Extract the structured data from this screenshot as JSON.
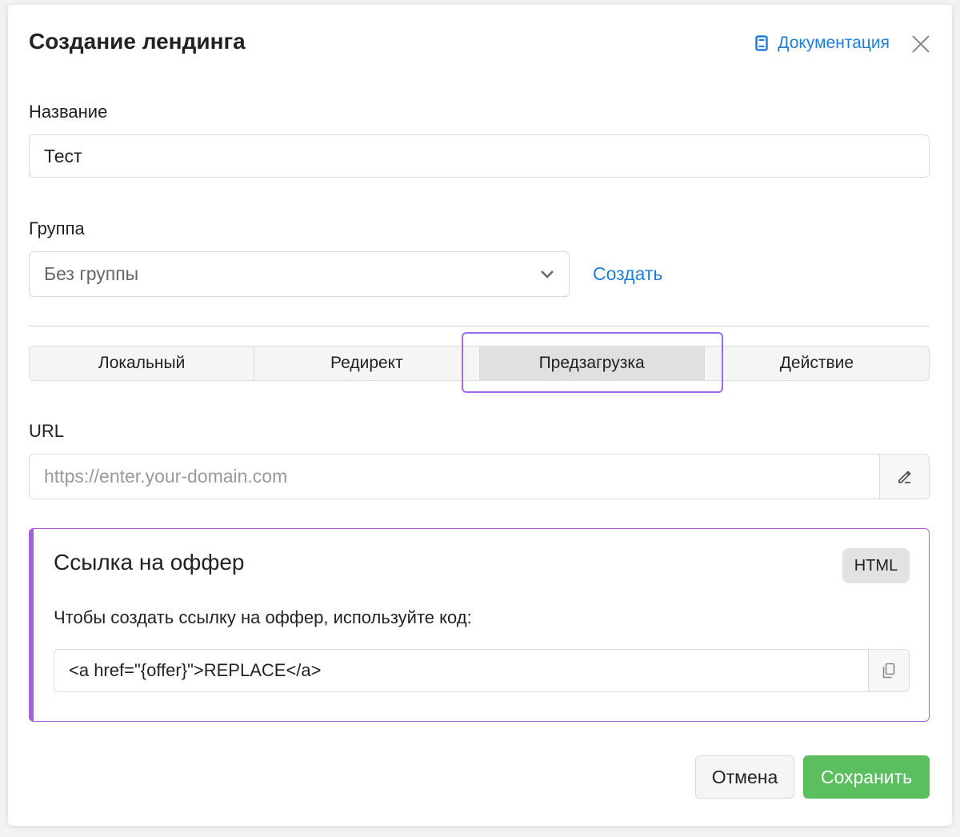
{
  "dialog": {
    "title": "Создание лендинга",
    "docs_label": "Документация"
  },
  "form": {
    "name_label": "Название",
    "name_value": "Тест",
    "group_label": "Группа",
    "group_value": "Без группы",
    "create_label": "Создать"
  },
  "tabs": [
    {
      "label": "Локальный",
      "active": false
    },
    {
      "label": "Редирект",
      "active": false
    },
    {
      "label": "Предзагрузка",
      "active": true
    },
    {
      "label": "Действие",
      "active": false
    }
  ],
  "url": {
    "label": "URL",
    "placeholder": "https://enter.your-domain.com"
  },
  "offer": {
    "title": "Ссылка на оффер",
    "badge": "HTML",
    "description": "Чтобы создать ссылку на оффер, используйте код:",
    "code": "<a href=\"{offer}\">REPLACE</a>"
  },
  "actions": {
    "cancel_label": "Отмена",
    "save_label": "Сохранить"
  },
  "colors": {
    "accent_link": "#1f7fd6",
    "offer_border": "#a65fd6",
    "focus_ring": "#9b6cf0",
    "save_button": "#5cbf5f"
  }
}
